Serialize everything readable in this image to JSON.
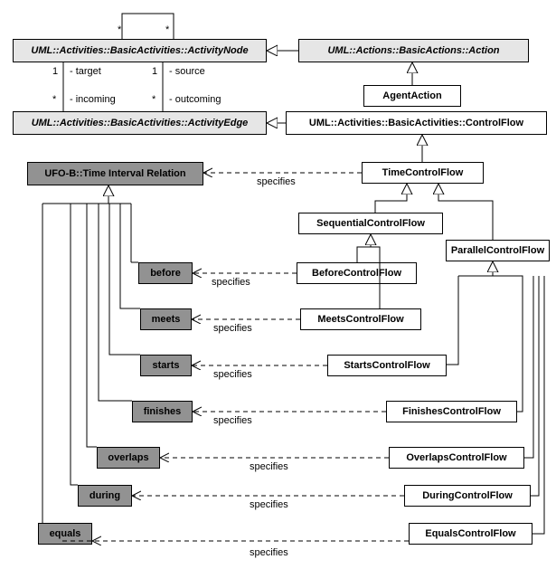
{
  "boxes": {
    "activityNode": "UML::Activities::BasicActivities::ActivityNode",
    "action": "UML::Actions::BasicActions::Action",
    "agentAction": "AgentAction",
    "activityEdge": "UML::Activities::BasicActivities::ActivityEdge",
    "controlFlow": "UML::Activities::BasicActivities::ControlFlow",
    "ufoB": "UFO-B::Time Interval Relation",
    "timeControlFlow": "TimeControlFlow",
    "sequentialControlFlow": "SequentialControlFlow",
    "parallelControlFlow": "ParallelControlFlow",
    "before": "before",
    "meets": "meets",
    "starts": "starts",
    "finishes": "finishes",
    "overlaps": "overlaps",
    "during": "during",
    "equals": "equals",
    "beforeCF": "BeforeControlFlow",
    "meetsCF": "MeetsControlFlow",
    "startsCF": "StartsControlFlow",
    "finishesCF": "FinishesControlFlow",
    "overlapsCF": "OverlapsControlFlow",
    "duringCF": "DuringControlFlow",
    "equalsCF": "EqualsControlFlow"
  },
  "labels": {
    "star": "*",
    "one": "1",
    "target": "- target",
    "source": "- source",
    "incoming": "- incoming",
    "outcoming": "- outcoming",
    "specifies": "specifies"
  }
}
